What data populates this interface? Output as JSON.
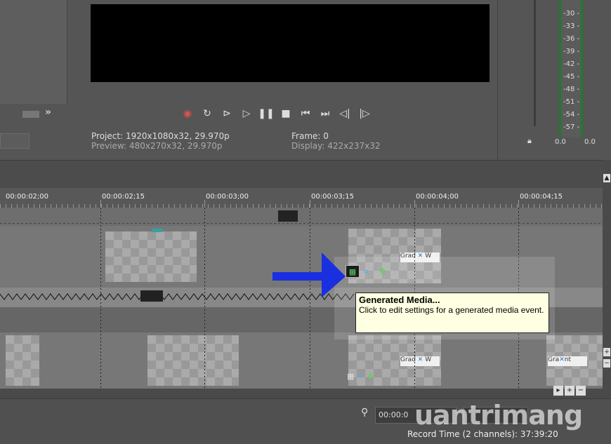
{
  "preview": {
    "project_label": "Project:",
    "project_value": "1920x1080x32, 29.970p",
    "preview_label": "Preview:",
    "preview_value": "480x270x32, 29.970p",
    "frame_label": "Frame:",
    "frame_value": "0",
    "display_label": "Display:",
    "display_value": "422x237x32"
  },
  "meter": {
    "ticks": [
      "-30 -",
      "-33 -",
      "-36 -",
      "-39 -",
      "-42 -",
      "-45 -",
      "-48 -",
      "-51 -",
      "-54 -",
      "-57 -"
    ],
    "left_value": "0.0",
    "right_value": "0.0"
  },
  "left_panel": {
    "more_label": "»"
  },
  "ruler": {
    "labels": [
      "00:00:02;00",
      "00:00:02;15",
      "00:00:03;00",
      "00:00:03;15",
      "00:00:04;00",
      "00:00:04;15"
    ]
  },
  "clips": {
    "grad_label_1": "Grad",
    "grad_label_2": "Grad",
    "grad_label_3": "Gra",
    "grad_suffix_1": "W",
    "grad_suffix_2": "W",
    "grad_suffix_3": "nt"
  },
  "tooltip": {
    "title": "Generated Media...",
    "body": "Click to edit settings for a generated media event."
  },
  "bottom": {
    "timecode": "00:00:0",
    "status": "Record Time (2 channels): 37:39:20",
    "watermark": "uantrimang"
  },
  "icons": {
    "transport": [
      "record-icon",
      "loop-icon",
      "play-from-start-icon",
      "play-icon",
      "pause-icon",
      "stop-icon",
      "prev-marker-icon",
      "next-marker-icon",
      "prev-frame-icon",
      "next-frame-icon"
    ]
  },
  "colors": {
    "arrow": "#1a2fe0",
    "tooltip_bg": "#ffffe1",
    "record": "#e05050"
  }
}
